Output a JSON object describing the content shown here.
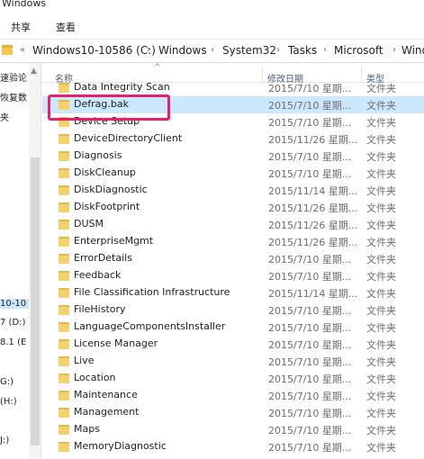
{
  "window": {
    "title": "Windows"
  },
  "ribbon": {
    "tabs": [
      "共享",
      "查看"
    ]
  },
  "address": {
    "crumbs": [
      "Windows10-10586 (C:)",
      "Windows",
      "System32",
      "Tasks",
      "Microsoft",
      "Windo"
    ],
    "back_chevrons": "«"
  },
  "nav": {
    "items": [
      "速验论",
      "恢复数",
      "夹",
      "10-10",
      "7 (D:)",
      "8.1 (E",
      "G:)",
      "(H:)",
      "J:)"
    ],
    "selected_index": 3
  },
  "columns": {
    "name": "名称",
    "date": "修改日期",
    "type": "类型"
  },
  "rows": [
    {
      "name": "Data Integrity Scan",
      "date": "2015/7/10 星期...",
      "type": "文件夹"
    },
    {
      "name": "Defrag.bak",
      "date": "2015/7/10 星期...",
      "type": "文件夹"
    },
    {
      "name": "Device Setup",
      "date": "2015/7/10 星期...",
      "type": "文件夹"
    },
    {
      "name": "DeviceDirectoryClient",
      "date": "2015/11/26 星期...",
      "type": "文件夹"
    },
    {
      "name": "Diagnosis",
      "date": "2015/7/10 星期...",
      "type": "文件夹"
    },
    {
      "name": "DiskCleanup",
      "date": "2015/7/10 星期...",
      "type": "文件夹"
    },
    {
      "name": "DiskDiagnostic",
      "date": "2015/11/14 星期...",
      "type": "文件夹"
    },
    {
      "name": "DiskFootprint",
      "date": "2015/11/26 星期...",
      "type": "文件夹"
    },
    {
      "name": "DUSM",
      "date": "2015/11/26 星期...",
      "type": "文件夹"
    },
    {
      "name": "EnterpriseMgmt",
      "date": "2015/11/26 星期...",
      "type": "文件夹"
    },
    {
      "name": "ErrorDetails",
      "date": "2015/7/10 星期...",
      "type": "文件夹"
    },
    {
      "name": "Feedback",
      "date": "2015/7/10 星期...",
      "type": "文件夹"
    },
    {
      "name": "File Classification Infrastructure",
      "date": "2015/11/14 星期...",
      "type": "文件夹"
    },
    {
      "name": "FileHistory",
      "date": "2015/7/10 星期...",
      "type": "文件夹"
    },
    {
      "name": "LanguageComponentsInstaller",
      "date": "2015/7/10 星期...",
      "type": "文件夹"
    },
    {
      "name": "License Manager",
      "date": "2015/7/10 星期...",
      "type": "文件夹"
    },
    {
      "name": "Live",
      "date": "2015/7/10 星期...",
      "type": "文件夹"
    },
    {
      "name": "Location",
      "date": "2015/7/10 星期...",
      "type": "文件夹"
    },
    {
      "name": "Maintenance",
      "date": "2015/7/10 星期...",
      "type": "文件夹"
    },
    {
      "name": "Management",
      "date": "2015/7/10 星期...",
      "type": "文件夹"
    },
    {
      "name": "Maps",
      "date": "2015/7/10 星期...",
      "type": "文件夹"
    },
    {
      "name": "MemoryDiagnostic",
      "date": "2015/7/10 星期...",
      "type": "文件夹"
    }
  ],
  "selected_row_index": 1,
  "colors": {
    "selection": "#cce8ff",
    "highlight_border": "#e8206b",
    "folder": "#f7d26b"
  }
}
